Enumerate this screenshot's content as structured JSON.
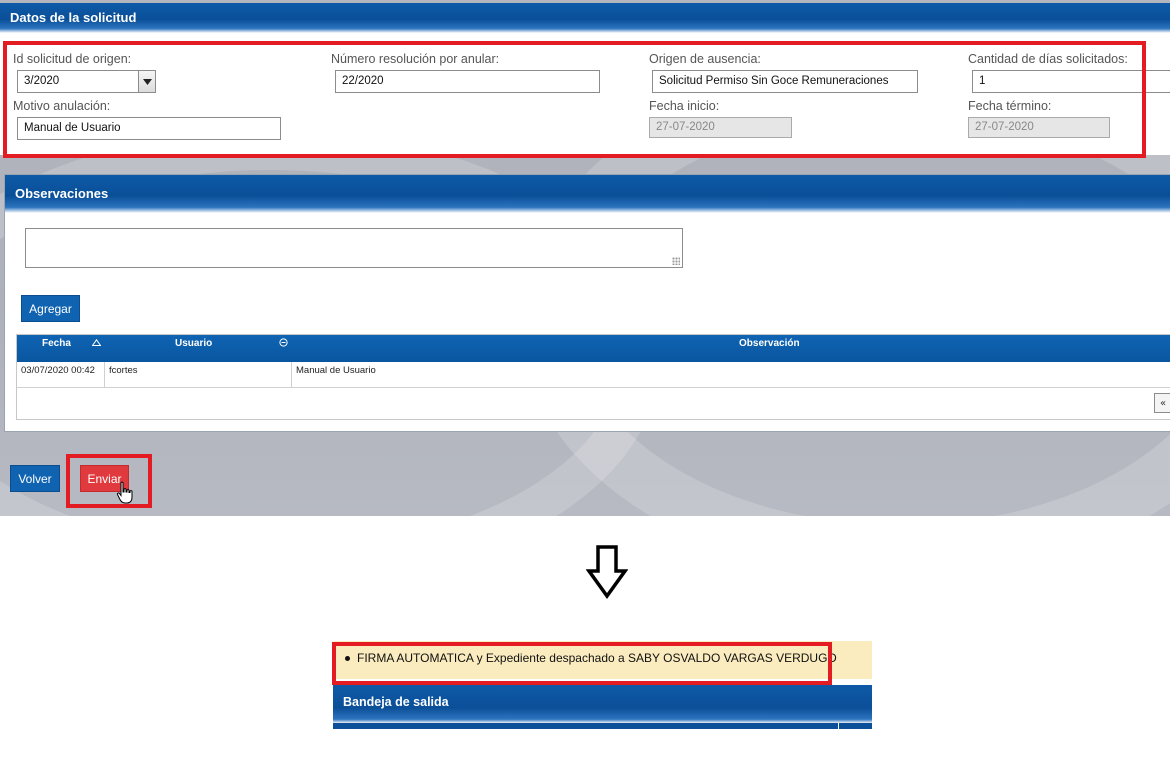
{
  "section1": {
    "title": "Datos de la solicitud",
    "fields": {
      "id_solicitud": {
        "label": "Id solicitud de origen:",
        "value": "3/2020"
      },
      "numero_resolucion": {
        "label": "Número resolución por anular:",
        "value": "22/2020"
      },
      "origen_ausencia": {
        "label": "Origen de ausencia:",
        "value": "Solicitud Permiso Sin Goce Remuneraciones"
      },
      "cantidad_dias": {
        "label": "Cantidad de días solicitados:",
        "value": "1"
      },
      "motivo_anulacion": {
        "label": "Motivo anulación:",
        "value": "Manual de Usuario"
      },
      "fecha_inicio": {
        "label": "Fecha inicio:",
        "value": "27-07-2020"
      },
      "fecha_termino": {
        "label": "Fecha término:",
        "value": "27-07-2020"
      }
    }
  },
  "section2": {
    "title": "Observaciones",
    "textarea_value": "",
    "add_button": "Agregar",
    "grid": {
      "columns": [
        "Fecha",
        "Usuario",
        "Observación"
      ],
      "rows": [
        {
          "fecha": "03/07/2020 00:42",
          "usuario": "fcortes",
          "observacion": "Manual de Usuario"
        }
      ],
      "pager_first": "«"
    }
  },
  "actions": {
    "back": "Volver",
    "send": "Enviar"
  },
  "result": {
    "message": "FIRMA AUTOMATICA y Expediente despachado a SABY OSVALDO VARGAS VERDUGO",
    "outbox_title": "Bandeja de salida"
  },
  "colors": {
    "accent": "#0f63b1",
    "highlight": "#e31b23",
    "send_button": "#e03a3e",
    "message_background": "#faecbf"
  }
}
